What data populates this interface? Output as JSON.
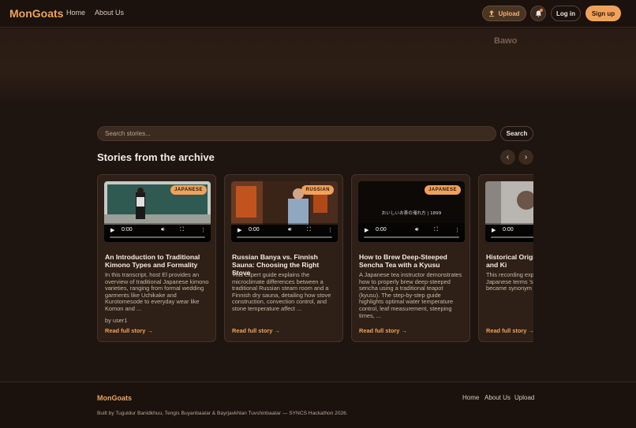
{
  "header": {
    "logo": "MonGoats",
    "nav": [
      "Home",
      "About Us"
    ],
    "upload_label": "Upload",
    "login_label": "Log in",
    "signup_label": "Sign up"
  },
  "hero": {
    "word": "Bawo"
  },
  "search": {
    "placeholder": "Search stories...",
    "button": "Search"
  },
  "section": {
    "title": "Stories from the archive",
    "prev": "‹",
    "next": "›"
  },
  "cards": [
    {
      "badge": "JAPANESE",
      "time": "0:00",
      "title": "An Introduction to Traditional Kimono Types and Formality",
      "desc": "In this transcript, host El provides an overview of traditional Japanese kimono varieties, ranging from formal wedding garments like Uchikake and Kurotomesode to everyday wear like Komon and ...",
      "by": "by user1",
      "link": "Read full story →"
    },
    {
      "badge": "RUSSIAN",
      "time": "0:00",
      "title": "Russian Banya vs. Finnish Sauna: Choosing the Right Stove",
      "desc": "This expert guide explains the microclimate differences between a traditional Russian steam room and a Finnish dry sauna, detailing how stove construction, convection control, and stone temperature affect ...",
      "by": "",
      "link": "Read full story →"
    },
    {
      "badge": "JAPANESE",
      "time": "0:00",
      "video_caption": "おいしいお茶の淹れ方 | 1899",
      "title": "How to Brew Deep-Steeped Sencha Tea with a Kyusu",
      "desc": "A Japanese tea instructor demonstrates how to properly brew deep-steeped sencha using a traditional teapot (kyusu). The step-by-step guide highlights optimal water temperature control, leaf measurement, steeping times, ...",
      "by": "",
      "link": "Read full story →"
    },
    {
      "badge": "",
      "time": "0:00",
      "title": "Historical Origins of Samurai and Ki",
      "desc": "This recording exp origins and linguis Japanese terms 's 'kimono'. It describ became synonym and how kimono b",
      "by": "",
      "link": "Read full story →"
    }
  ],
  "footer": {
    "logo": "MonGoats",
    "links": [
      "Home",
      "About Us",
      "Upload"
    ],
    "credit": "Built by Tuguldur Banidkhuu, Tengis Buyanbaatar & Bayrjavkhlan Tuvshinbaatar — SYNCS Hackathon 2026."
  }
}
